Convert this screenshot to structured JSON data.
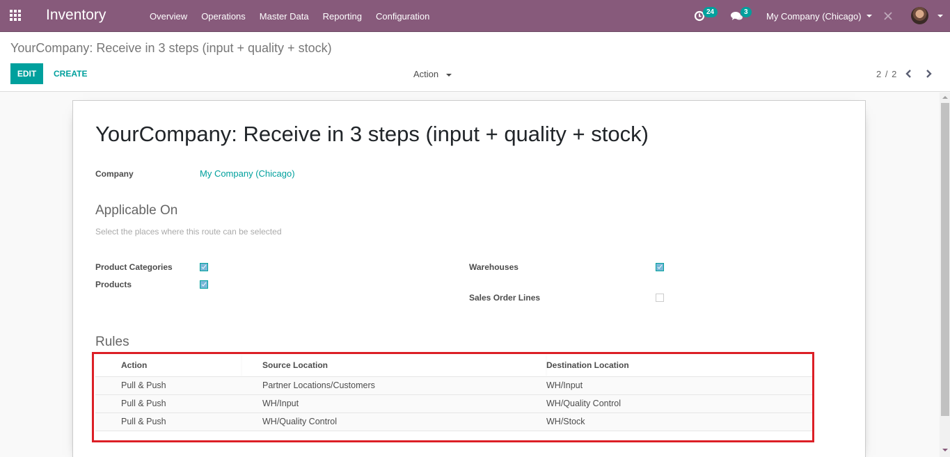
{
  "navbar": {
    "app_title": "Inventory",
    "menu": [
      "Overview",
      "Operations",
      "Master Data",
      "Reporting",
      "Configuration"
    ],
    "activity_count": "24",
    "messages_count": "3",
    "company": "My Company (Chicago)",
    "colors": {
      "brand": "#875a7b",
      "badge": "#00a09d"
    }
  },
  "control_panel": {
    "breadcrumb": "YourCompany: Receive in 3 steps (input + quality + stock)",
    "edit_label": "EDIT",
    "create_label": "CREATE",
    "action_label": "Action",
    "pager": "2 / 2"
  },
  "form": {
    "title": "YourCompany: Receive in 3 steps (input + quality + stock)",
    "company_label": "Company",
    "company_value": "My Company (Chicago)",
    "applicable_on": {
      "title": "Applicable On",
      "help": "Select the places where this route can be selected",
      "fields": [
        {
          "label": "Product Categories",
          "checked": true
        },
        {
          "label": "Products",
          "checked": true
        },
        {
          "label": "Warehouses",
          "checked": true
        },
        {
          "label": "Sales Order Lines",
          "checked": false
        }
      ]
    },
    "rules": {
      "title": "Rules",
      "columns": [
        "Action",
        "Source Location",
        "Destination Location"
      ],
      "rows": [
        [
          "Pull & Push",
          "Partner Locations/Customers",
          "WH/Input"
        ],
        [
          "Pull & Push",
          "WH/Input",
          "WH/Quality Control"
        ],
        [
          "Pull & Push",
          "WH/Quality Control",
          "WH/Stock"
        ]
      ],
      "highlight_color": "#dc1f26"
    }
  }
}
